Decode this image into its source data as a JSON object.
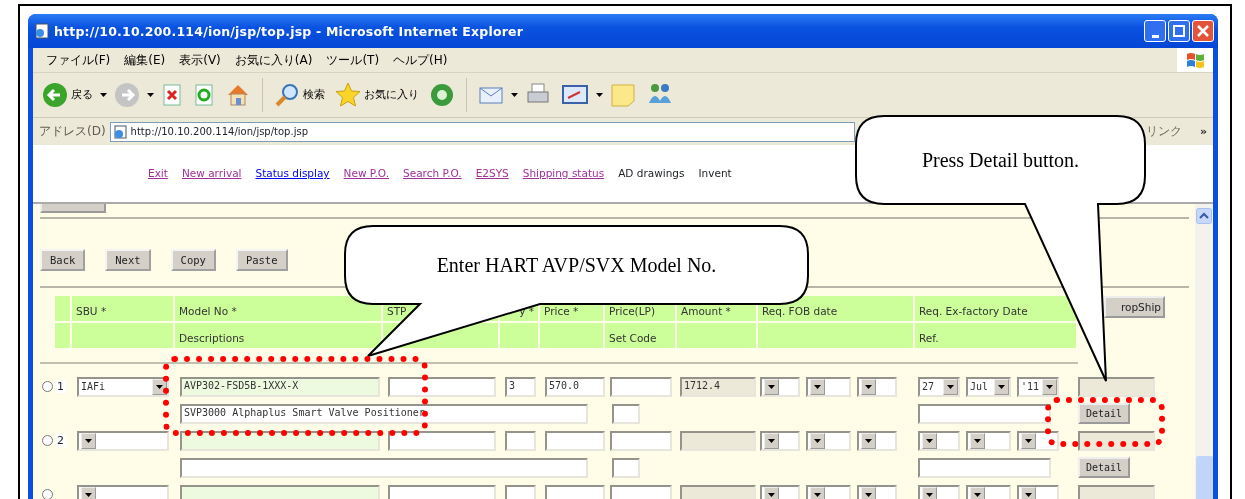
{
  "window": {
    "title": "http://10.10.200.114/ion/jsp/top.jsp - Microsoft Internet Explorer"
  },
  "menu": [
    "ファイル(F)",
    "編集(E)",
    "表示(V)",
    "お気に入り(A)",
    "ツール(T)",
    "ヘルプ(H)"
  ],
  "toolbar": [
    {
      "kind": "back",
      "label": "戻る"
    },
    {
      "kind": "forward"
    },
    {
      "kind": "stop"
    },
    {
      "kind": "refresh"
    },
    {
      "kind": "home"
    },
    {
      "kind": "search",
      "label": "検索"
    },
    {
      "kind": "favorites",
      "label": "お気に入り"
    },
    {
      "kind": "media"
    },
    {
      "kind": "mail"
    },
    {
      "kind": "print"
    },
    {
      "kind": "edit"
    },
    {
      "kind": "notes"
    },
    {
      "kind": "messenger"
    }
  ],
  "address_bar": {
    "label": "アドレス(D)",
    "url": "http://10.10.200.114/ion/jsp/top.jsp",
    "links_label": "リンク",
    "more": "»"
  },
  "nav_links": [
    {
      "kind": "link",
      "label": "Exit",
      "visited": true
    },
    {
      "kind": "link",
      "label": "New arrival",
      "visited": true
    },
    {
      "kind": "link",
      "label": "Status display",
      "visited": false
    },
    {
      "kind": "link",
      "label": "New P.O.",
      "visited": true
    },
    {
      "kind": "link",
      "label": "Search P.O.",
      "visited": true
    },
    {
      "kind": "link",
      "label": "E2SYS",
      "visited": true
    },
    {
      "kind": "link",
      "label": "Shipping status",
      "visited": true
    },
    {
      "kind": "text",
      "label": "AD drawings"
    },
    {
      "kind": "text",
      "label": "Invent"
    }
  ],
  "page_buttons": [
    "Back",
    "Next",
    "Copy",
    "Paste"
  ],
  "table": {
    "columns": [
      {
        "label": "SBU *"
      },
      {
        "label": "Model No *",
        "sub_label": "Descriptions"
      },
      {
        "label": "STP"
      },
      {
        "label": "y *"
      },
      {
        "label": "Price *"
      },
      {
        "label": "Price(LP)",
        "sub_label": "Set Code"
      },
      {
        "label": "Amount *"
      },
      {
        "label": "Req. FOB date"
      },
      {
        "label": "Req. Ex-factory Date",
        "sub_label": "Ref."
      },
      {
        "label": "ropShip",
        "kind": "button"
      }
    ],
    "rows": [
      {
        "number": "1",
        "selected": false,
        "sbu": "IAFi",
        "model_no": "AVP302-FSD5B-1XXX-X",
        "qty": "3",
        "price": "570.0",
        "amount": "1712.4",
        "ex_factory_date": [
          "27",
          "Jul",
          "'11"
        ],
        "description": "SVP3000 Alphaplus Smart Valve Positioner",
        "detail_button": "Detail"
      },
      {
        "number": "2",
        "selected": false,
        "detail_button": "Detail"
      },
      {
        "selected": false
      }
    ]
  },
  "callouts": [
    {
      "text": "Enter HART AVP/SVX Model No."
    },
    {
      "text": "Press Detail button."
    }
  ]
}
